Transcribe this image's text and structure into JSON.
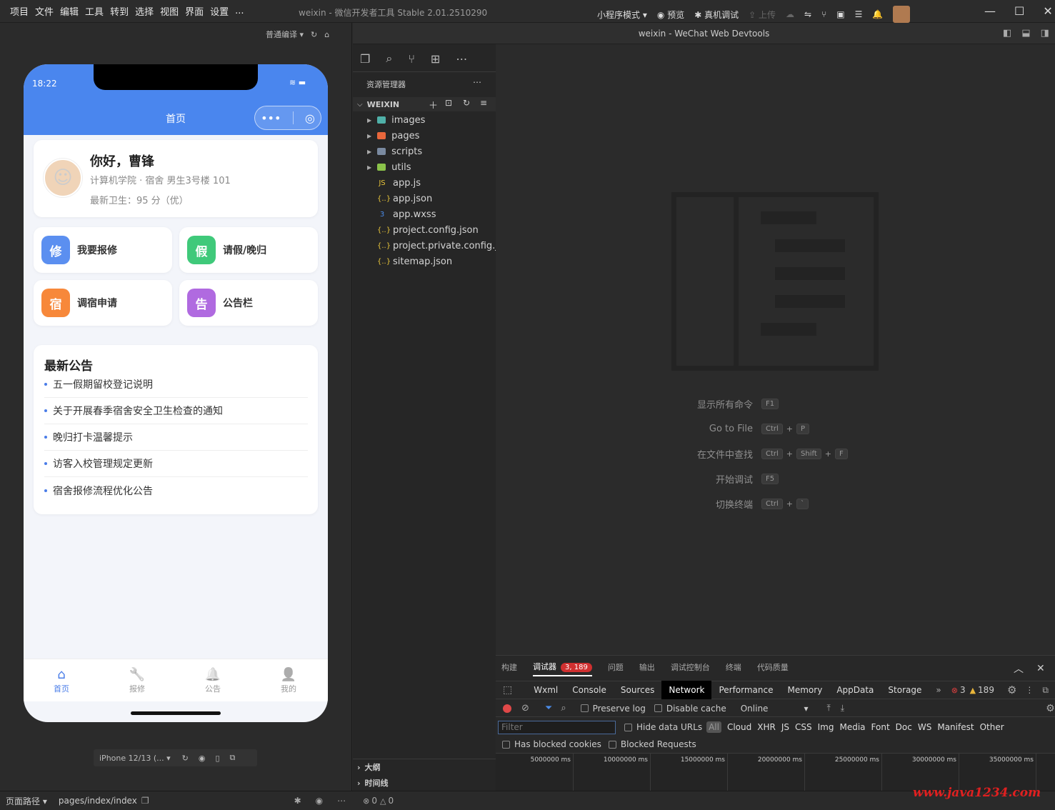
{
  "titlebar": {
    "menus": [
      "项目",
      "文件",
      "编辑",
      "工具",
      "转到",
      "选择",
      "视图",
      "界面",
      "设置",
      "..."
    ],
    "app_title": "weixin",
    "app_subtitle": "- 微信开发者工具 Stable 2.01.2510290",
    "mode": "小程序模式",
    "preview": "预览",
    "real_debug": "真机调试",
    "upload": "上传"
  },
  "simulator": {
    "compile_mode": "普通编译",
    "status_time": "18:22",
    "nav_title": "首页",
    "profile": {
      "greeting": "你好，曹锋",
      "info": "计算机学院 · 宿舍 男生3号楼 101",
      "score": "最新卫生：95 分（优）"
    },
    "quick": [
      {
        "icon": "修",
        "label": "我要报修",
        "color": "#5b8ff0"
      },
      {
        "icon": "假",
        "label": "请假/晚归",
        "color": "#3fc97a"
      },
      {
        "icon": "宿",
        "label": "调宿申请",
        "color": "#f7883a"
      },
      {
        "icon": "告",
        "label": "公告栏",
        "color": "#b06ae0"
      }
    ],
    "notices_title": "最新公告",
    "notices": [
      "五一假期留校登记说明",
      "关于开展春季宿舍安全卫生检查的通知",
      "晚归打卡温馨提示",
      "访客入校管理规定更新",
      "宿舍报修流程优化公告"
    ],
    "tabs": [
      {
        "label": "首页",
        "icon": "⌂",
        "active": true
      },
      {
        "label": "报修",
        "icon": "🔧",
        "active": false
      },
      {
        "label": "公告",
        "icon": "🔔",
        "active": false
      },
      {
        "label": "我的",
        "icon": "👤",
        "active": false
      }
    ],
    "device": "iPhone 12/13 (..."
  },
  "editor_header": "weixin - WeChat Web Devtools",
  "explorer": {
    "title": "资源管理器",
    "root": "WEIXIN",
    "folders": [
      {
        "name": "images",
        "color": "#4fb0a8"
      },
      {
        "name": "pages",
        "color": "#e8673c"
      },
      {
        "name": "scripts",
        "color": "#7a8aa0"
      },
      {
        "name": "utils",
        "color": "#8bc34a"
      }
    ],
    "files": [
      {
        "name": "app.js",
        "icon": "JS",
        "color": "#e8c53a"
      },
      {
        "name": "app.json",
        "icon": "{..}",
        "color": "#e8c53a"
      },
      {
        "name": "app.wxss",
        "icon": "3",
        "color": "#4a8be8"
      },
      {
        "name": "project.config.json",
        "icon": "{..}",
        "color": "#e8c53a"
      },
      {
        "name": "project.private.config.js...",
        "icon": "{..}",
        "color": "#e8c53a"
      },
      {
        "name": "sitemap.json",
        "icon": "{..}",
        "color": "#e8c53a"
      }
    ],
    "outline": "大纲",
    "timeline": "时间线"
  },
  "shortcuts": [
    {
      "label": "显示所有命令",
      "keys": [
        "F1"
      ]
    },
    {
      "label": "Go to File",
      "keys": [
        "Ctrl",
        "P"
      ]
    },
    {
      "label": "在文件中查找",
      "keys": [
        "Ctrl",
        "Shift",
        "F"
      ]
    },
    {
      "label": "开始调试",
      "keys": [
        "F5"
      ]
    },
    {
      "label": "切换终端",
      "keys": [
        "Ctrl",
        "`"
      ]
    }
  ],
  "devtools": {
    "top_tabs": [
      "构建",
      "调试器",
      "问题",
      "输出",
      "调试控制台",
      "终端",
      "代码质量"
    ],
    "debugger_badge": "3, 189",
    "panel_tabs": [
      "Wxml",
      "Console",
      "Sources",
      "Network",
      "Performance",
      "Memory",
      "AppData",
      "Storage"
    ],
    "errors": "3",
    "warnings": "189",
    "preserve_log": "Preserve log",
    "disable_cache": "Disable cache",
    "throttle": "Online",
    "filter_placeholder": "Filter",
    "hide_data_urls": "Hide data URLs",
    "types": [
      "All",
      "Cloud",
      "XHR",
      "JS",
      "CSS",
      "Img",
      "Media",
      "Font",
      "Doc",
      "WS",
      "Manifest",
      "Other"
    ],
    "has_blocked": "Has blocked cookies",
    "blocked_requests": "Blocked Requests",
    "timeline_ticks": [
      "5000000 ms",
      "10000000 ms",
      "15000000 ms",
      "20000000 ms",
      "25000000 ms",
      "30000000 ms",
      "35000000 ms"
    ]
  },
  "statusbar": {
    "page_path_label": "页面路径",
    "page_path": "pages/index/index",
    "errors": "0",
    "warnings": "0",
    "watermark": "www.java1234.com"
  }
}
